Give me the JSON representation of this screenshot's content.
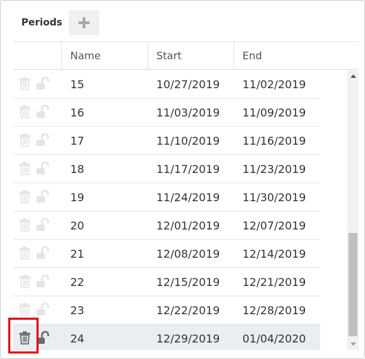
{
  "panel": {
    "title": "Periods",
    "add_icon": "plus-icon"
  },
  "columns": {
    "name": "Name",
    "start": "Start",
    "end": "End"
  },
  "rows": [
    {
      "name": "15",
      "start": "10/27/2019",
      "end": "11/02/2019"
    },
    {
      "name": "16",
      "start": "11/03/2019",
      "end": "11/09/2019"
    },
    {
      "name": "17",
      "start": "11/10/2019",
      "end": "11/16/2019"
    },
    {
      "name": "18",
      "start": "11/17/2019",
      "end": "11/23/2019"
    },
    {
      "name": "19",
      "start": "11/24/2019",
      "end": "11/30/2019"
    },
    {
      "name": "20",
      "start": "12/01/2019",
      "end": "12/07/2019"
    },
    {
      "name": "21",
      "start": "12/08/2019",
      "end": "12/14/2019"
    },
    {
      "name": "22",
      "start": "12/15/2019",
      "end": "12/21/2019"
    },
    {
      "name": "23",
      "start": "12/22/2019",
      "end": "12/28/2019"
    },
    {
      "name": "24",
      "start": "12/29/2019",
      "end": "01/04/2020"
    }
  ],
  "row_icons": {
    "delete": "trash-icon",
    "lock": "unlock-icon"
  },
  "selected_row": "24",
  "colors": {
    "highlight_border": "#e3000f",
    "selected_row_bg": "#eaedf1",
    "icon_disabled": "#e4e4e4",
    "icon_active": "#6b6b6b"
  }
}
